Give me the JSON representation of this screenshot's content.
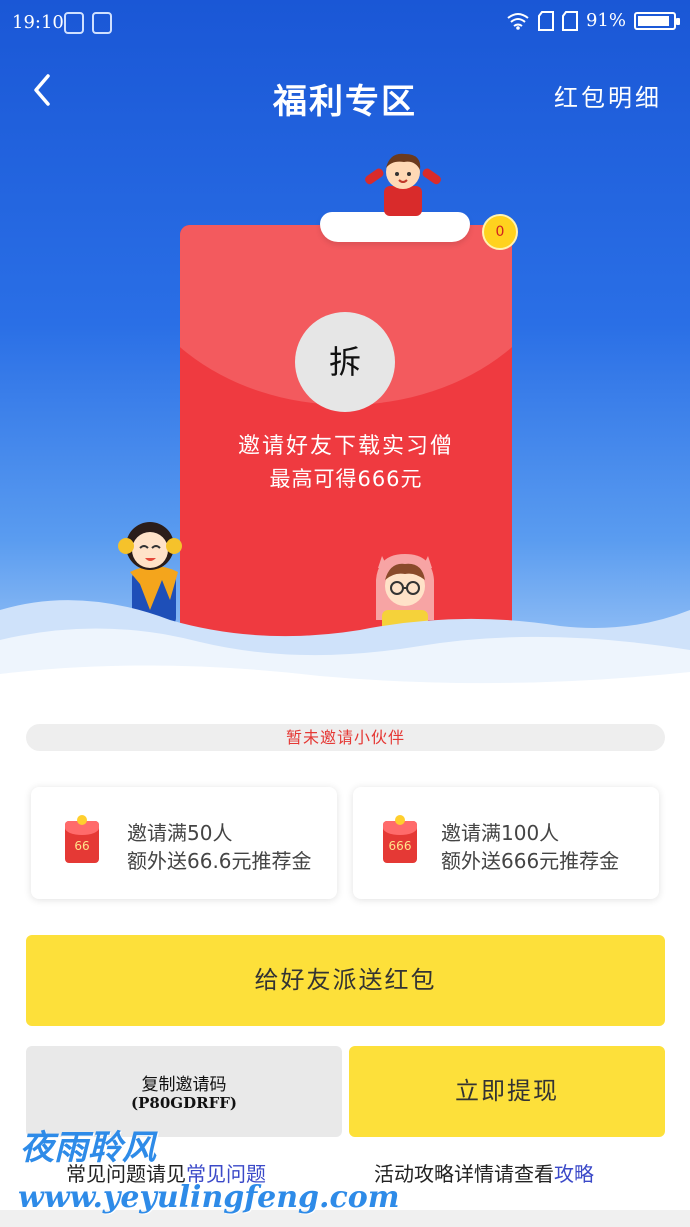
{
  "status_bar": {
    "time": "19:10",
    "battery": "91%",
    "battery_level": 0.91
  },
  "nav": {
    "title": "福利专区",
    "right_link": "红包明细",
    "back_icon": "chevron-left-icon"
  },
  "envelope": {
    "badge": "0",
    "open_label": "拆",
    "line1": "邀请好友下载实习僧",
    "line2": "最高可得666元"
  },
  "progress": {
    "text": "暂未邀请小伙伴"
  },
  "rewards": [
    {
      "icon_value": "66",
      "line1": "邀请满50人",
      "line2": "额外送66.6元推荐金"
    },
    {
      "icon_value": "666",
      "line1": "邀请满100人",
      "line2": "额外送666元推荐金"
    }
  ],
  "actions": {
    "send_label": "给好友派送红包",
    "copy_line1": "复制邀请码",
    "copy_code": "(P80GDRFF)",
    "withdraw_label": "立即提现"
  },
  "footer": {
    "faq_prefix": "常见问题请见",
    "faq_link": "常见问题",
    "guide_prefix": "活动攻略详情请查看",
    "guide_link": "攻略"
  },
  "watermark": {
    "line1": "夜雨聆风",
    "line2": "www.yeyulingfeng.com"
  },
  "colors": {
    "hero_blue": "#1a57d6",
    "envelope_red": "#ef3a40",
    "button_yellow": "#fde03a",
    "link_blue": "#3b49c8"
  }
}
